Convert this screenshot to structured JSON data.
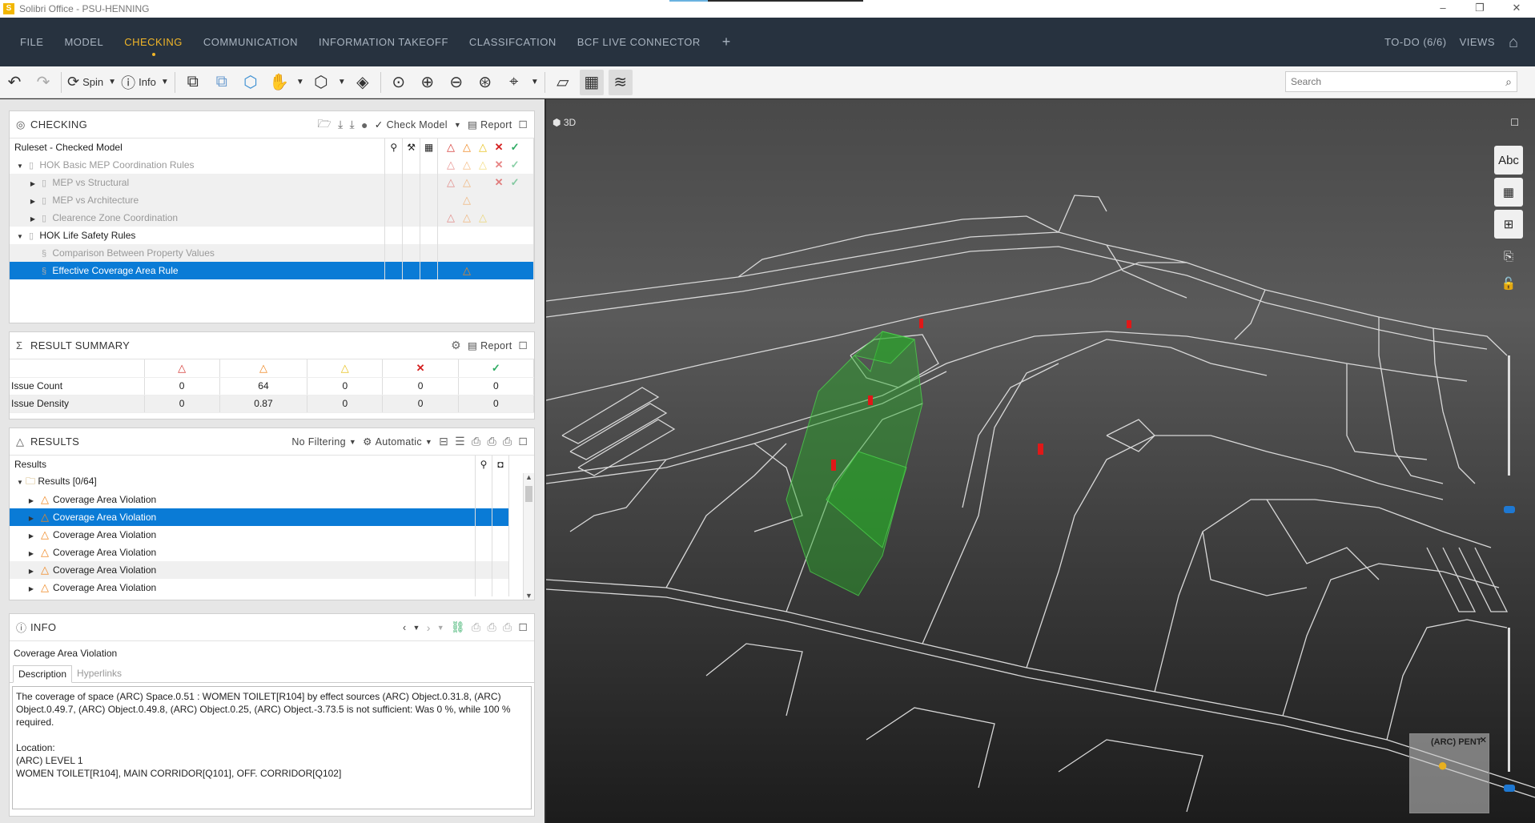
{
  "window": {
    "title": "Solibri Office - PSU-HENNING",
    "app_icon": "S",
    "minimize": "–",
    "maximize": "❐",
    "close": "✕"
  },
  "menu": {
    "items": [
      "FILE",
      "MODEL",
      "CHECKING",
      "COMMUNICATION",
      "INFORMATION TAKEOFF",
      "CLASSIFCATION",
      "BCF LIVE CONNECTOR"
    ],
    "active": "CHECKING",
    "plus": "+",
    "todo": "TO-DO (6/6)",
    "views": "VIEWS",
    "accent_color": "#f0b528",
    "bg_color": "#27323f"
  },
  "toolbar": {
    "spin": "Spin",
    "info": "Info",
    "search_placeholder": "Search"
  },
  "checking": {
    "title": "CHECKING",
    "check_model": "Check Model",
    "report": "Report",
    "header": "Ruleset - Checked Model",
    "rows": [
      {
        "label": "HOK Basic MEP Coordination Rules",
        "level": 0,
        "expand": "▼",
        "dim": true,
        "sev": "red,ora,yel,x,ok"
      },
      {
        "label": "MEP vs Structural",
        "level": 1,
        "expand": "▶",
        "dim": true,
        "sev": "red,ora,,x,ok"
      },
      {
        "label": "MEP vs Architecture",
        "level": 1,
        "expand": "▶",
        "dim": true,
        "sev": ",ora,,,"
      },
      {
        "label": "Clearence Zone Coordination",
        "level": 1,
        "expand": "▶",
        "dim": true,
        "sev": "red,ora,yel,,"
      },
      {
        "label": "HOK Life Safety Rules",
        "level": 0,
        "expand": "▼",
        "dim": false,
        "sev": ",,,,"
      },
      {
        "label": "Comparison Between Property Values",
        "level": 1,
        "expand": "",
        "dim": true,
        "sev": ",,,,"
      },
      {
        "label": "Effective Coverage Area Rule",
        "level": 1,
        "expand": "",
        "dim": false,
        "sev": ",ora,,,",
        "selected": true
      }
    ]
  },
  "summary": {
    "title": "RESULT SUMMARY",
    "report": "Report",
    "rows": [
      {
        "label": "Issue Count",
        "values": [
          "0",
          "64",
          "0",
          "0",
          "0"
        ]
      },
      {
        "label": "Issue Density",
        "values": [
          "0",
          "0.87",
          "0",
          "0",
          "0"
        ]
      }
    ]
  },
  "results": {
    "title": "RESULTS",
    "filter": "No Filtering",
    "mode": "Automatic",
    "header": "Results",
    "group": "Results [0/64]",
    "items": [
      {
        "label": "Coverage Area Violation"
      },
      {
        "label": "Coverage Area Violation",
        "selected": true
      },
      {
        "label": "Coverage Area Violation"
      },
      {
        "label": "Coverage Area Violation"
      },
      {
        "label": "Coverage Area Violation"
      },
      {
        "label": "Coverage Area Violation"
      }
    ]
  },
  "info": {
    "title": "INFO",
    "item_title": "Coverage Area Violation",
    "tabs": [
      "Description",
      "Hyperlinks"
    ],
    "active_tab": "Description",
    "description": "The coverage of space (ARC) Space.0.51 : WOMEN TOILET[R104] by effect sources (ARC) Object.0.31.8, (ARC) Object.0.49.7, (ARC) Object.0.49.8, (ARC) Object.0.25, (ARC) Object.-3.73.5 is not sufficient: Was 0 %, while 100 % required.\n\nLocation:\n(ARC) LEVEL 1\nWOMEN TOILET[R104], MAIN CORRIDOR[Q101], OFF. CORRIDOR[Q102]"
  },
  "view3d": {
    "label": "3D",
    "navcube_label": "(ARC) PENT",
    "abc": "Abc"
  },
  "severity_colors": {
    "critical": "#d53a35",
    "moderate": "#ef8a26",
    "low": "#e8c21f",
    "rejected": "#d42020",
    "accepted": "#2dab62",
    "selection": "#0a7bd6"
  }
}
